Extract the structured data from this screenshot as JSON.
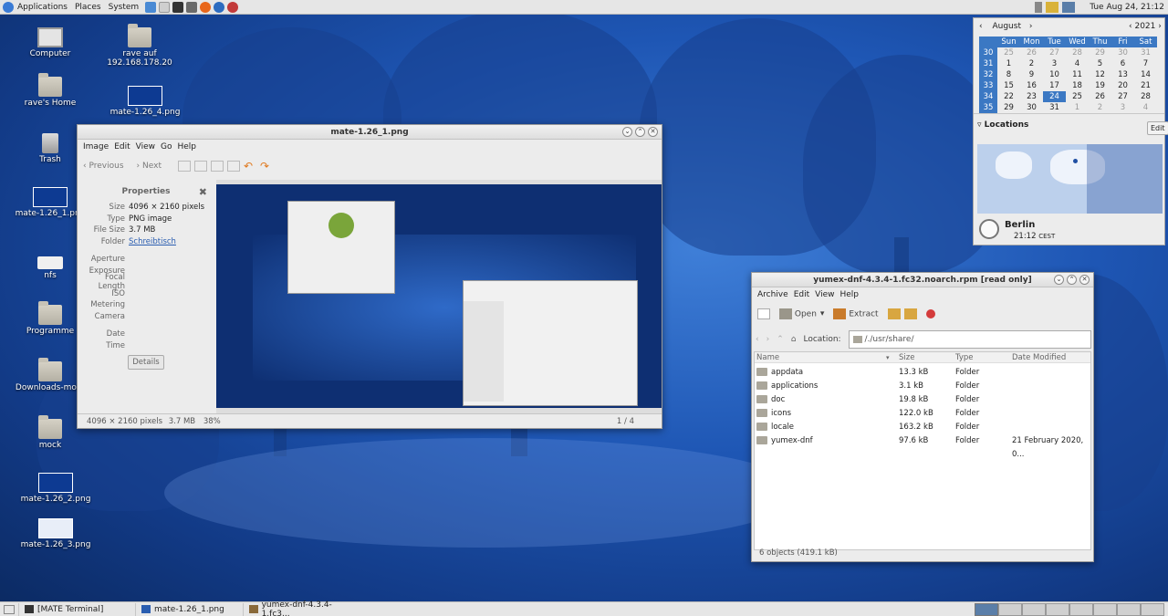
{
  "top_panel": {
    "menus": [
      "Applications",
      "Places",
      "System"
    ],
    "clock": "Tue Aug 24, 21:12"
  },
  "desktop_icons": [
    {
      "label": "Computer",
      "icon": "computer-icon"
    },
    {
      "label": "rave auf 192.168.178.20",
      "icon": "network-folder-icon"
    },
    {
      "label": "rave's Home",
      "icon": "home-folder-icon"
    },
    {
      "label": "mate-1.26_4.png",
      "icon": "image-file-icon"
    },
    {
      "label": "Trash",
      "icon": "trash-icon"
    },
    {
      "label": "mate-1.26_1.png",
      "icon": "image-file-icon"
    },
    {
      "label": "nfs",
      "icon": "drive-icon"
    },
    {
      "label": "Programme",
      "icon": "folder-icon"
    },
    {
      "label": "Downloads-moth",
      "icon": "folder-icon"
    },
    {
      "label": "mock",
      "icon": "folder-icon"
    },
    {
      "label": "mate-1.26_2.png",
      "icon": "image-file-icon"
    },
    {
      "label": "mate-1.26_3.png",
      "icon": "image-file-icon"
    }
  ],
  "image_viewer": {
    "title": "mate-1.26_1.png",
    "menu": [
      "Image",
      "Edit",
      "View",
      "Go",
      "Help"
    ],
    "toolbar": {
      "previous": "Previous",
      "next": "Next"
    },
    "properties": {
      "title": "Properties",
      "rows": [
        {
          "key": "Size",
          "value": "4096 × 2160 pixels"
        },
        {
          "key": "Type",
          "value": "PNG image"
        },
        {
          "key": "File Size",
          "value": "3.7 MB"
        },
        {
          "key": "Folder",
          "value": "Schreibtisch"
        }
      ],
      "exif_rows": [
        "Aperture",
        "Exposure",
        "Focal Length",
        "ISO",
        "Metering",
        "Camera"
      ],
      "date_rows": [
        "Date",
        "Time"
      ],
      "details_button": "Details"
    },
    "status": {
      "dims": "4096 × 2160 pixels",
      "size": "3.7 MB",
      "zoom": "38%",
      "page": "1 / 4"
    }
  },
  "calendar": {
    "month": "August",
    "year": "2021",
    "weekdays": [
      "Sun",
      "Mon",
      "Tue",
      "Wed",
      "Thu",
      "Fri",
      "Sat"
    ],
    "weeks": [
      {
        "wk": "30",
        "days": [
          "25",
          "26",
          "27",
          "28",
          "29",
          "30",
          "31"
        ]
      },
      {
        "wk": "31",
        "days": [
          "1",
          "2",
          "3",
          "4",
          "5",
          "6",
          "7"
        ]
      },
      {
        "wk": "32",
        "days": [
          "8",
          "9",
          "10",
          "11",
          "12",
          "13",
          "14"
        ]
      },
      {
        "wk": "33",
        "days": [
          "15",
          "16",
          "17",
          "18",
          "19",
          "20",
          "21"
        ]
      },
      {
        "wk": "34",
        "days": [
          "22",
          "23",
          "24",
          "25",
          "26",
          "27",
          "28"
        ]
      },
      {
        "wk": "35",
        "days": [
          "29",
          "30",
          "31",
          "1",
          "2",
          "3",
          "4"
        ]
      }
    ],
    "today": "24",
    "locations_label": "Locations",
    "edit_button": "Edit",
    "city": "Berlin",
    "time": "21:12",
    "tz": "CEST"
  },
  "archive_manager": {
    "title": "yumex-dnf-4.3.4-1.fc32.noarch.rpm [read only]",
    "menu": [
      "Archive",
      "Edit",
      "View",
      "Help"
    ],
    "toolbar": {
      "open": "Open",
      "extract": "Extract"
    },
    "location_label": "Location:",
    "location_value": "/./usr/share/",
    "columns": [
      "Name",
      "Size",
      "Type",
      "Date Modified"
    ],
    "rows": [
      {
        "name": "appdata",
        "size": "13.3 kB",
        "type": "Folder",
        "date": ""
      },
      {
        "name": "applications",
        "size": "3.1 kB",
        "type": "Folder",
        "date": ""
      },
      {
        "name": "doc",
        "size": "19.8 kB",
        "type": "Folder",
        "date": ""
      },
      {
        "name": "icons",
        "size": "122.0 kB",
        "type": "Folder",
        "date": ""
      },
      {
        "name": "locale",
        "size": "163.2 kB",
        "type": "Folder",
        "date": ""
      },
      {
        "name": "yumex-dnf",
        "size": "97.6 kB",
        "type": "Folder",
        "date": "21 February 2020, 0..."
      }
    ],
    "status": "6 objects (419.1 kB)"
  },
  "taskbar": [
    {
      "label": "[MATE Terminal]",
      "icon": "terminal-icon"
    },
    {
      "label": "mate-1.26_1.png",
      "icon": "image-viewer-icon"
    },
    {
      "label": "yumex-dnf-4.3.4-1.fc3...",
      "icon": "archive-icon"
    }
  ],
  "colors": {
    "accent": "#3b78c3",
    "panel": "#e6e6e6",
    "desktop": "#1e56b4"
  }
}
